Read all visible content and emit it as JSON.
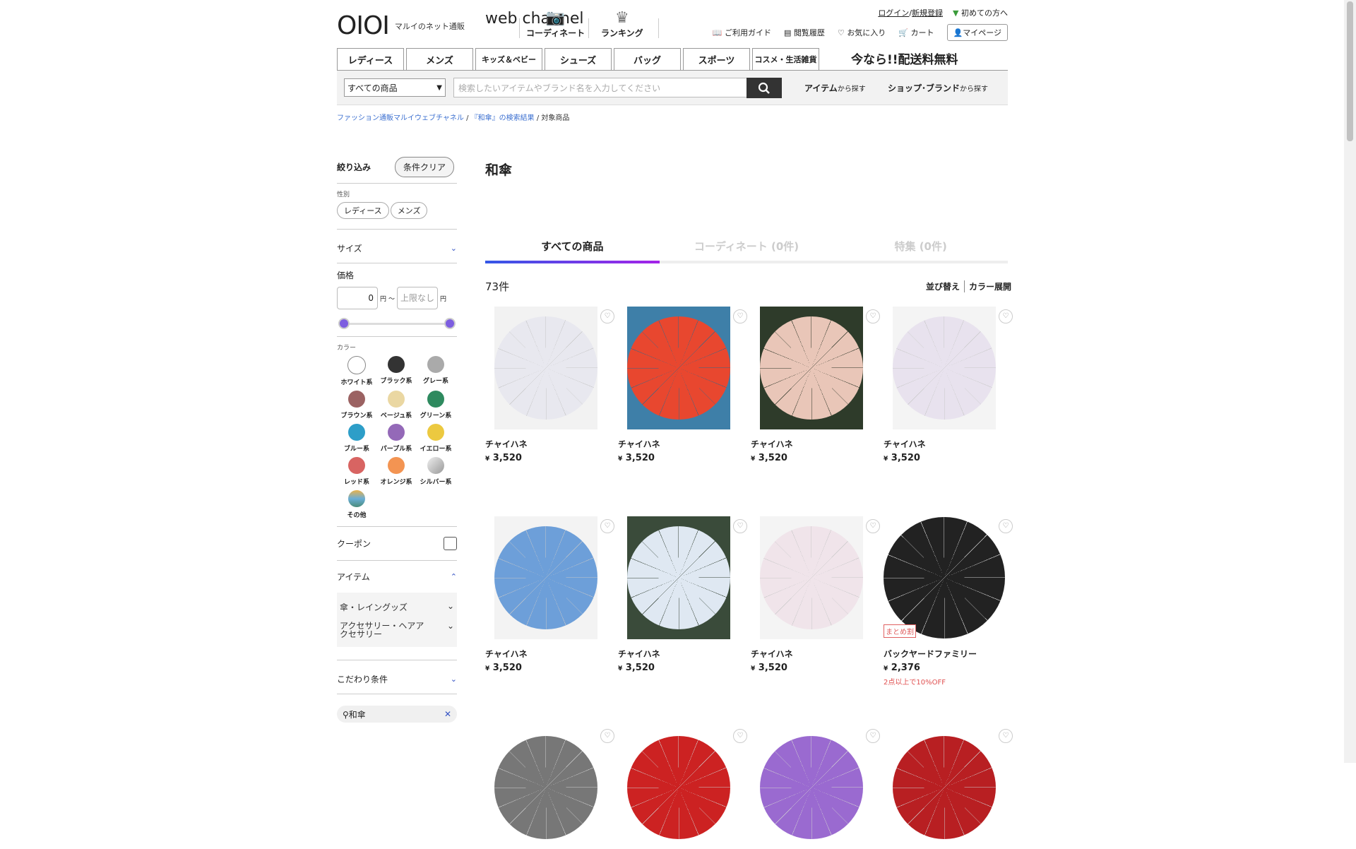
{
  "header": {
    "logo_mark": "OIOI",
    "logo_sub": "マルイのネット通販",
    "logo_main": "web channel",
    "nav_coordinate": "コーディネート",
    "nav_ranking": "ランキング",
    "login": "ログイン",
    "register": "新規登録",
    "first_time": "初めての方へ",
    "guide": "ご利用ガイド",
    "history": "閲覧履歴",
    "favorites": "お気に入り",
    "cart": "カート",
    "mypage": "マイページ"
  },
  "categories": [
    "レディース",
    "メンズ",
    "キッズ＆ベビー",
    "シューズ",
    "バッグ",
    "スポーツ",
    "コスメ・生活雑貨"
  ],
  "promo": "今なら!!配送料無料",
  "search": {
    "select_value": "すべての商品",
    "placeholder": "検索したいアイテムやブランド名を入力してください",
    "item_search": "アイテム",
    "item_search_suffix": "から探す",
    "shop_search": "ショップ･ブランド",
    "shop_search_suffix": "から探す"
  },
  "breadcrumb": {
    "home": "ファッション通販マルイウェブチャネル",
    "results": "『和傘』の検索結果",
    "current": "対象商品"
  },
  "sidebar": {
    "filter_label": "絞り込み",
    "clear_label": "条件クリア",
    "gender_label": "性別",
    "gender_options": [
      "レディース",
      "メンズ"
    ],
    "size_label": "サイズ",
    "price_label": "価格",
    "price_min": "0",
    "price_max_placeholder": "上限なし",
    "yen": "円",
    "tilde": "～",
    "color_label": "カラー",
    "colors": [
      {
        "name": "ホワイト系",
        "hex": "#ffffff"
      },
      {
        "name": "ブラック系",
        "hex": "#333333"
      },
      {
        "name": "グレー系",
        "hex": "#aaaaaa"
      },
      {
        "name": "ブラウン系",
        "hex": "#9b6262"
      },
      {
        "name": "ベージュ系",
        "hex": "#ead7a2"
      },
      {
        "name": "グリーン系",
        "hex": "#2e8a5f"
      },
      {
        "name": "ブルー系",
        "hex": "#2d9ec8"
      },
      {
        "name": "パープル系",
        "hex": "#9469b8"
      },
      {
        "name": "イエロー系",
        "hex": "#ecc940"
      },
      {
        "name": "レッド系",
        "hex": "#d86462"
      },
      {
        "name": "オレンジ系",
        "hex": "#f39452"
      },
      {
        "name": "シルバー系",
        "hex": "#bbbbbb"
      },
      {
        "name": "その他",
        "hex": "#6aaed6"
      }
    ],
    "coupon_label": "クーポン",
    "item_label": "アイテム",
    "item_subs": [
      "傘・レイングッズ",
      "アクセサリー・ヘアアクセサリー"
    ],
    "kodawari_label": "こだわり条件",
    "search_keyword": "和傘"
  },
  "main": {
    "title": "和傘",
    "tabs": [
      "すべての商品",
      "コーディネート (0件)",
      "特集 (0件)"
    ],
    "count": "73件",
    "sort_label": "並び替え",
    "color_expand": "カラー展開",
    "products": [
      {
        "brand": "チャイハネ",
        "price": "3,520",
        "bg": "#f2f2f2",
        "umb": "#e8e8ef"
      },
      {
        "brand": "チャイハネ",
        "price": "3,520",
        "bg": "#3e7fa8",
        "umb": "#e8472f"
      },
      {
        "brand": "チャイハネ",
        "price": "3,520",
        "bg": "#2e3b2a",
        "umb": "#e9c6b8"
      },
      {
        "brand": "チャイハネ",
        "price": "3,520",
        "bg": "#f4f4f4",
        "umb": "#e8e2ee"
      },
      {
        "brand": "チャイハネ",
        "price": "3,520",
        "bg": "#f3f3f3",
        "umb": "#6d9fd9"
      },
      {
        "brand": "チャイハネ",
        "price": "3,520",
        "bg": "#3a4b3a",
        "umb": "#dfe8f2"
      },
      {
        "brand": "チャイハネ",
        "price": "3,520",
        "bg": "#f4f4f4",
        "umb": "#f0e4ea"
      },
      {
        "brand": "バックヤードファミリー",
        "price": "2,376",
        "bg": "#ffffff",
        "umb": "#222222",
        "badge": "まとめ割",
        "note": "2点以上で10%OFF"
      },
      {
        "brand": "",
        "price": "",
        "bg": "#ffffff",
        "umb": "#777777"
      },
      {
        "brand": "",
        "price": "",
        "bg": "#ffffff",
        "umb": "#cc2222"
      },
      {
        "brand": "",
        "price": "",
        "bg": "#ffffff",
        "umb": "#9a6ad0"
      },
      {
        "brand": "",
        "price": "",
        "bg": "#ffffff",
        "umb": "#b81f22"
      }
    ],
    "yen_mark": "¥"
  }
}
